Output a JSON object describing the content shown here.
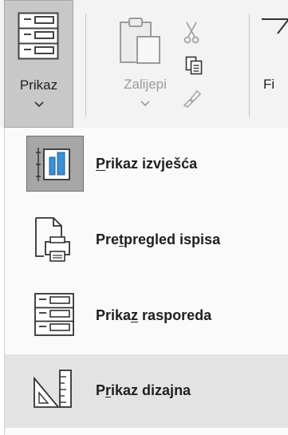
{
  "ribbon": {
    "view_button": {
      "label": "Prikaz",
      "icon": "view-icon"
    },
    "paste_button": {
      "label": "Zalijepi",
      "icon": "clipboard-icon",
      "enabled": false
    },
    "cut_icon": "scissors-icon",
    "copy_icon": "copy-icon",
    "format_painter_icon": "format-painter-icon",
    "filter_button": {
      "label": "Fi",
      "icon": "filter-icon"
    }
  },
  "view_menu": {
    "items": [
      {
        "pre": "",
        "key": "P",
        "post": "rikaz izvješća",
        "icon": "report-view-icon",
        "state": "selected"
      },
      {
        "pre": "Pre",
        "key": "t",
        "post": "pregled ispisa",
        "icon": "print-preview-icon",
        "state": "normal"
      },
      {
        "pre": "Prika",
        "key": "z",
        "post": " rasporeda",
        "icon": "layout-view-icon",
        "state": "normal"
      },
      {
        "pre": "P",
        "key": "r",
        "post": "ikaz dizajna",
        "icon": "design-view-icon",
        "state": "hover"
      }
    ]
  }
}
